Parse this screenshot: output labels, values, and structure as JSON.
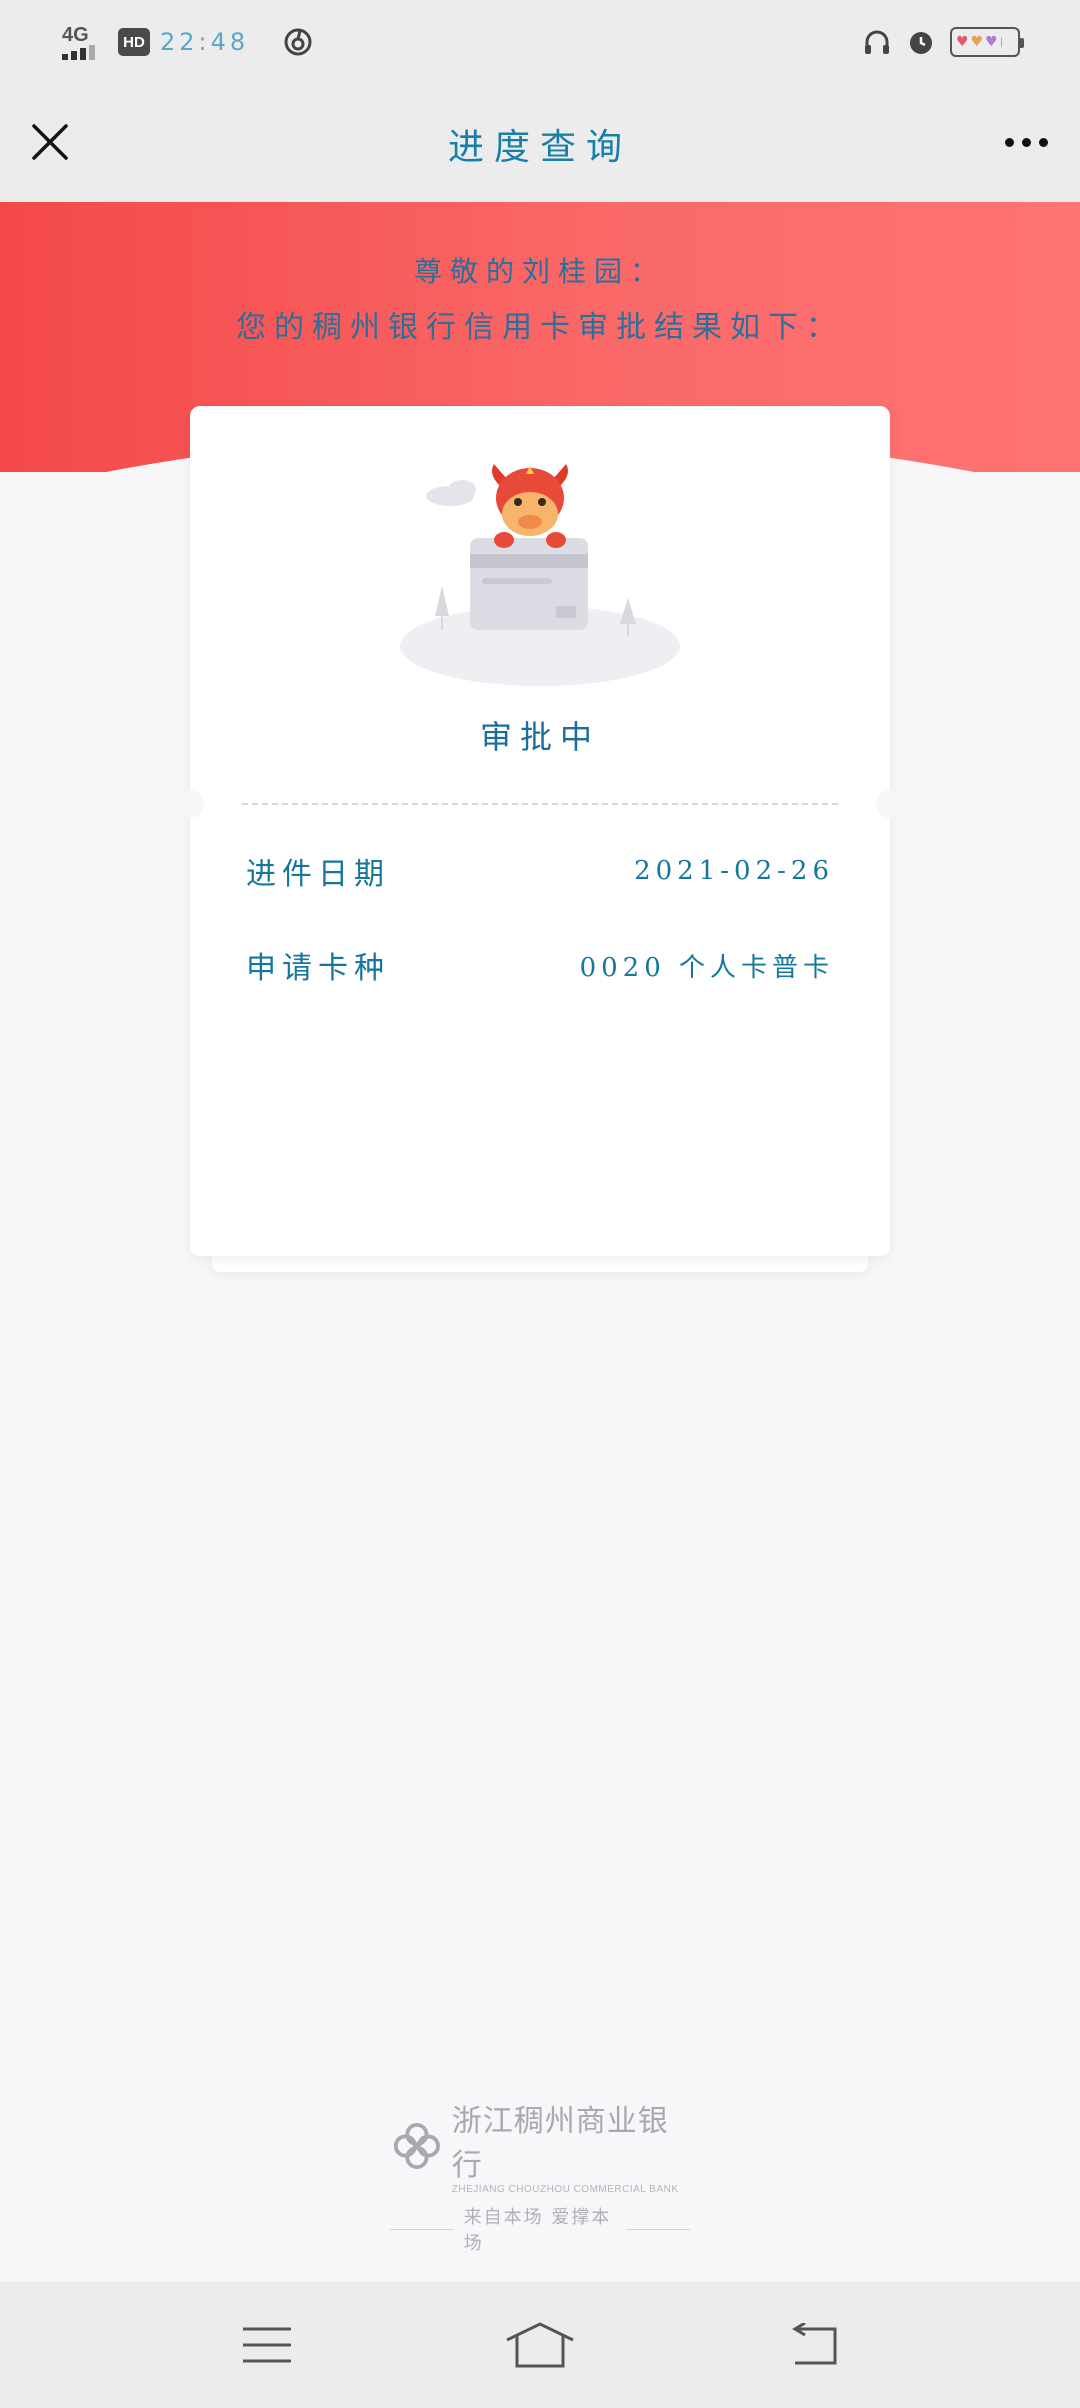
{
  "status_bar": {
    "network": "4G",
    "hd": "HD",
    "time": "22:48"
  },
  "header": {
    "title": "进度查询"
  },
  "banner": {
    "greeting_line1": "尊敬的刘桂园：",
    "greeting_line2": "您的稠州银行信用卡审批结果如下："
  },
  "card": {
    "status": "审批中",
    "rows": [
      {
        "label": "进件日期",
        "value": "2021-02-26"
      },
      {
        "label": "申请卡种",
        "value": "0020 个人卡普卡"
      }
    ]
  },
  "footer": {
    "bank_name": "浙江稠州商业银行",
    "bank_name_en": "ZHEJIANG CHOUZHOU COMMERCIAL BANK",
    "slogan": "来自本场 爱撑本场"
  },
  "colors": {
    "banner_start": "#f44848",
    "banner_end": "#ff7474",
    "text_accent": "#1a7fa8"
  },
  "icons": {
    "close": "close-icon",
    "more": "more-icon",
    "menu": "menu-icon",
    "home": "home-icon",
    "back": "back-icon"
  }
}
